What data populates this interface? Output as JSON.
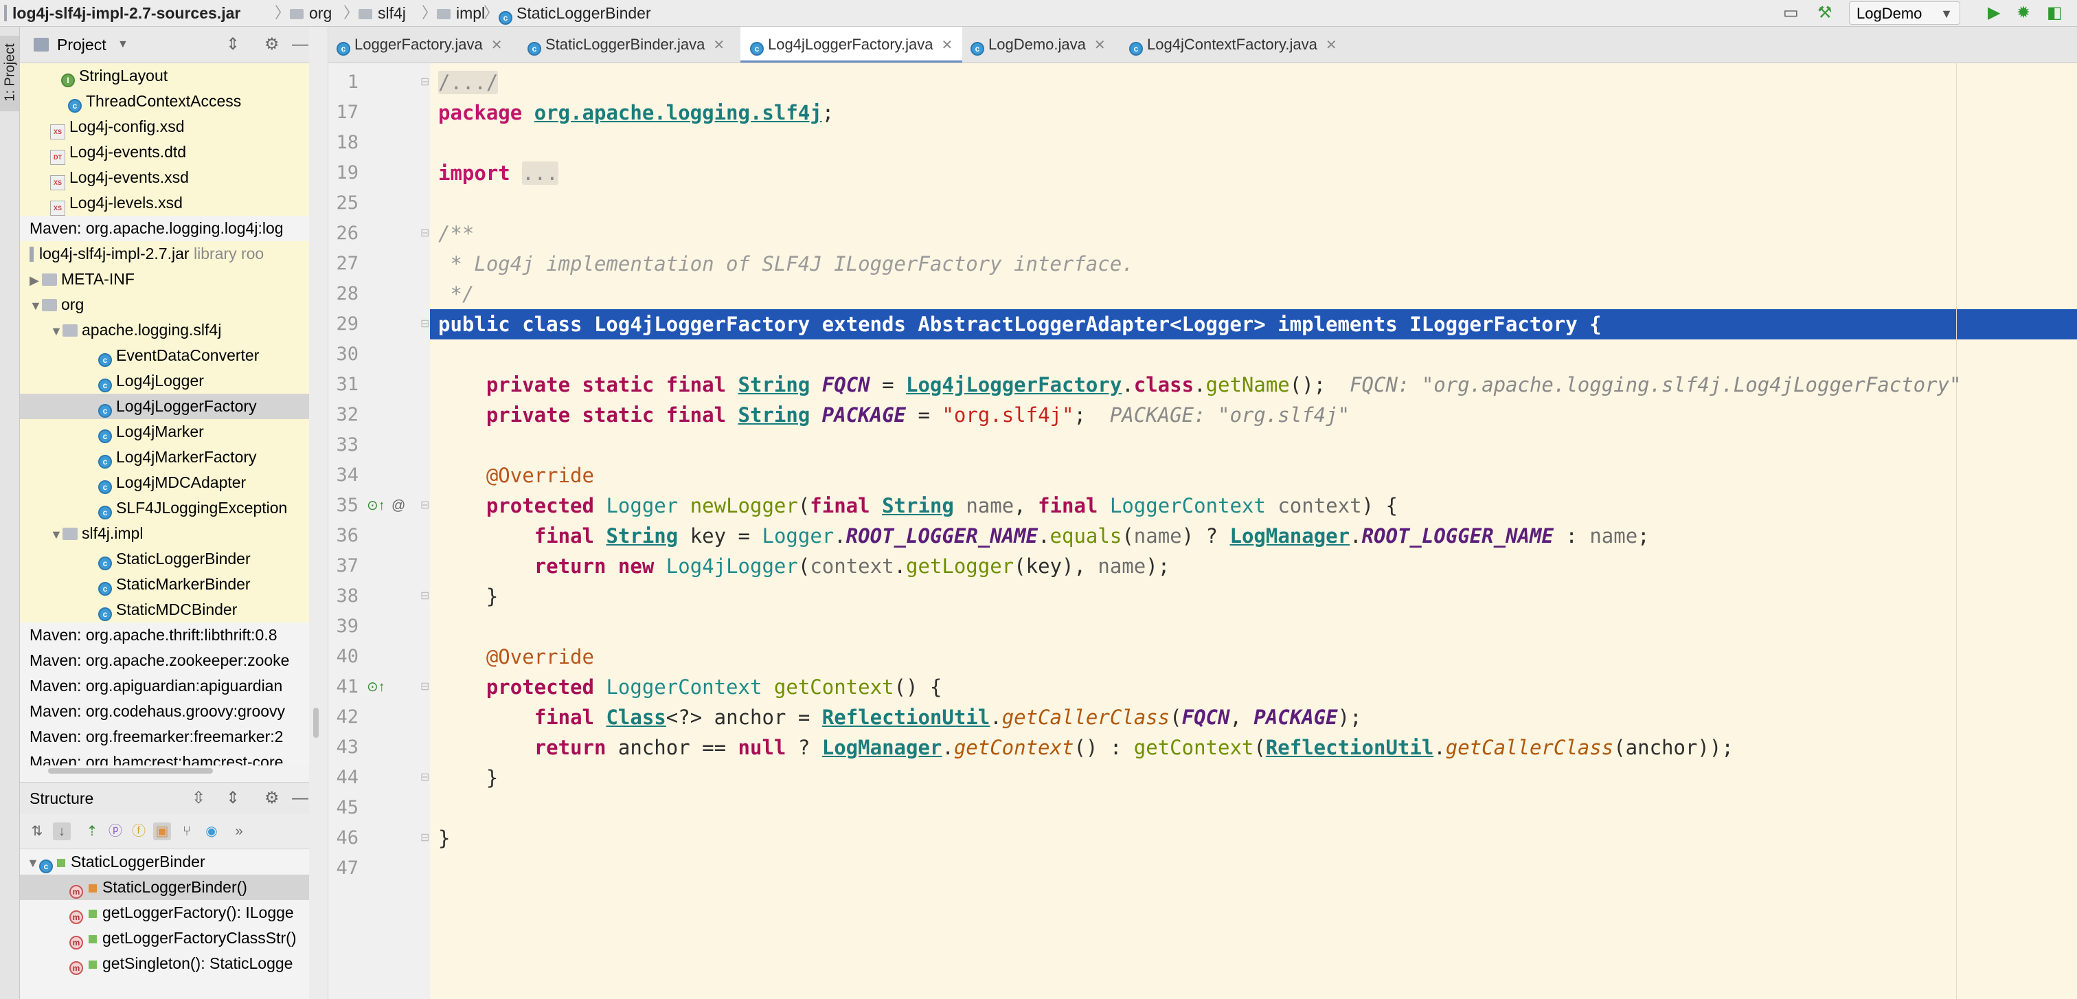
{
  "navbar": {
    "crumbs": [
      "log4j-slf4j-impl-2.7-sources.jar",
      "org",
      "slf4j",
      "impl",
      "StaticLoggerBinder"
    ],
    "run_config": "LogDemo"
  },
  "left_strip": {
    "project_tab": "1: Project"
  },
  "project_panel": {
    "title": "Project",
    "items": [
      {
        "text": "StringLayout",
        "icon": "interface-icon"
      },
      {
        "text": "ThreadContextAccess",
        "icon": "class-icon"
      },
      {
        "text": "Log4j-config.xsd",
        "icon": "xsd-icon"
      },
      {
        "text": "Log4j-events.dtd",
        "icon": "dtd-icon"
      },
      {
        "text": "Log4j-events.xsd",
        "icon": "xsd-icon"
      },
      {
        "text": "Log4j-levels.xsd",
        "icon": "xsd-icon"
      },
      {
        "text": "Maven: org.apache.logging.log4j:log",
        "icon": "library-icon"
      },
      {
        "text": "log4j-slf4j-impl-2.7.jar",
        "note": "library roo",
        "icon": "jar-icon"
      },
      {
        "text": "META-INF",
        "icon": "package-icon"
      },
      {
        "text": "org",
        "icon": "package-icon"
      },
      {
        "text": "apache.logging.slf4j",
        "icon": "package-icon"
      },
      {
        "text": "EventDataConverter",
        "icon": "class-icon"
      },
      {
        "text": "Log4jLogger",
        "icon": "class-icon"
      },
      {
        "text": "Log4jLoggerFactory",
        "icon": "class-icon"
      },
      {
        "text": "Log4jMarker",
        "icon": "class-icon"
      },
      {
        "text": "Log4jMarkerFactory",
        "icon": "class-icon"
      },
      {
        "text": "Log4jMDCAdapter",
        "icon": "class-icon"
      },
      {
        "text": "SLF4JLoggingException",
        "icon": "class-icon"
      },
      {
        "text": "slf4j.impl",
        "icon": "package-icon"
      },
      {
        "text": "StaticLoggerBinder",
        "icon": "class-icon"
      },
      {
        "text": "StaticMarkerBinder",
        "icon": "class-icon"
      },
      {
        "text": "StaticMDCBinder",
        "icon": "class-icon"
      },
      {
        "text": "Maven: org.apache.thrift:libthrift:0.8",
        "icon": "library-icon"
      },
      {
        "text": "Maven: org.apache.zookeeper:zooke",
        "icon": "library-icon"
      },
      {
        "text": "Maven: org.apiguardian:apiguardian",
        "icon": "library-icon"
      },
      {
        "text": "Maven: org.codehaus.groovy:groovy",
        "icon": "library-icon"
      },
      {
        "text": "Maven: org.freemarker:freemarker:2",
        "icon": "library-icon"
      },
      {
        "text": "Maven: org.hamcrest:hamcrest-core",
        "icon": "library-icon"
      }
    ]
  },
  "structure_panel": {
    "title": "Structure",
    "root": "StaticLoggerBinder",
    "items": [
      "StaticLoggerBinder()",
      "getLoggerFactory(): ILogge",
      "getLoggerFactoryClassStr()",
      "getSingleton(): StaticLogge"
    ]
  },
  "tabs": [
    {
      "label": "LoggerFactory.java"
    },
    {
      "label": "StaticLoggerBinder.java"
    },
    {
      "label": "Log4jLoggerFactory.java"
    },
    {
      "label": "LogDemo.java"
    },
    {
      "label": "Log4jContextFactory.java"
    }
  ],
  "editor": {
    "line_numbers": [
      "1",
      "17",
      "18",
      "19",
      "25",
      "26",
      "27",
      "28",
      "29",
      "30",
      "31",
      "32",
      "33",
      "34",
      "35",
      "36",
      "37",
      "38",
      "39",
      "40",
      "41",
      "42",
      "43",
      "44",
      "45",
      "46",
      "47"
    ],
    "t": {
      "l1": "/.../",
      "l17a": "package ",
      "l17b": "org.apache.logging.slf4j",
      "l17c": ";",
      "l19a": "import ",
      "l19b": "...",
      "l26": "/**",
      "l27": " * Log4j implementation of SLF4J ILoggerFactory interface.",
      "l28": " */",
      "l29": "public class Log4jLoggerFactory extends AbstractLoggerAdapter<Logger> implements ILoggerFactory {",
      "kw_private": "private",
      "kw_static": "static",
      "kw_final": "final",
      "String": "String",
      "fqcn": "FQCN",
      "eq": " = ",
      "l4jf": "Log4jLoggerFactory",
      "dot": ".",
      "kw_class": "class",
      "getName": "getName",
      "callend": "();",
      "fqcn_hint": "FQCN: \"org.apache.logging.slf4j.Log4jLoggerFactory\"",
      "package_f": "PACKAGE",
      "str_slf4j": "\"org.slf4j\"",
      "semi": ";",
      "package_hint": "PACKAGE: \"org.slf4j\"",
      "override": "@Override",
      "kw_protected": "protected",
      "Logger": "Logger",
      "newLogger": "newLogger",
      "po": "(",
      "name": "name",
      "comma": ", ",
      "LoggerContext": "LoggerContext",
      "context": "context",
      "pcb": ") {",
      "key": "key",
      "rln": "ROOT_LOGGER_NAME",
      "equals": "equals",
      "pc": ")",
      "q": " ? ",
      "LogManager": "LogManager",
      "colon": " : ",
      "kw_return": "return",
      "kw_new": "new",
      "Log4jLogger": "Log4jLogger",
      "getLogger": "getLogger",
      "rb": "}",
      "getContext": "getContext",
      "pob": "() {",
      "Class": "Class",
      "wild": "<?>",
      "anchor": "anchor",
      "ReflectionUtil": "ReflectionUtil",
      "getCallerClass": "getCallerClass",
      "eqeq": " == ",
      "kw_null": "null",
      "emptycall": "()",
      "end2": "));"
    }
  }
}
